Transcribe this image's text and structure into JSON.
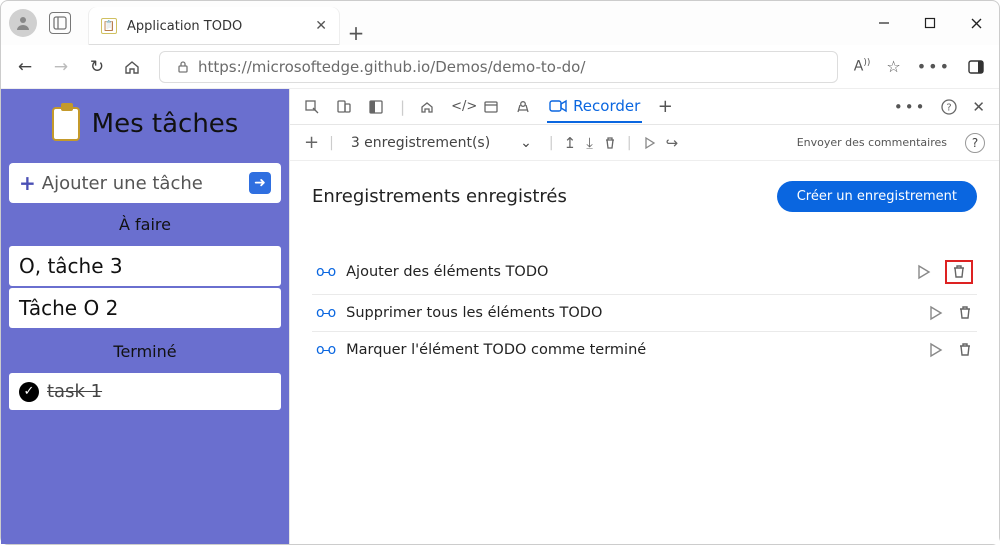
{
  "tab": {
    "title": "Application TODO"
  },
  "url": "https://microsoftedge.github.io/Demos/demo-to-do/",
  "todo": {
    "title": "Mes tâches",
    "add_placeholder": "Ajouter une tâche",
    "section_todo": "À faire",
    "section_done": "Terminé",
    "tasks_open": [
      "O, tâche 3",
      "Tâche O 2"
    ],
    "tasks_done": [
      "task 1"
    ]
  },
  "devtools": {
    "recorder_tab": "Recorder",
    "dropdown_count": "3 enregistrement(s)",
    "feedback": "Envoyer des commentaires",
    "headline": "Enregistrements enregistrés",
    "create_button": "Créer un enregistrement",
    "recordings": [
      "Ajouter des éléments TODO",
      "Supprimer tous les éléments TODO",
      "Marquer l'élément TODO comme terminé"
    ],
    "highlighted_delete_index": 0
  }
}
